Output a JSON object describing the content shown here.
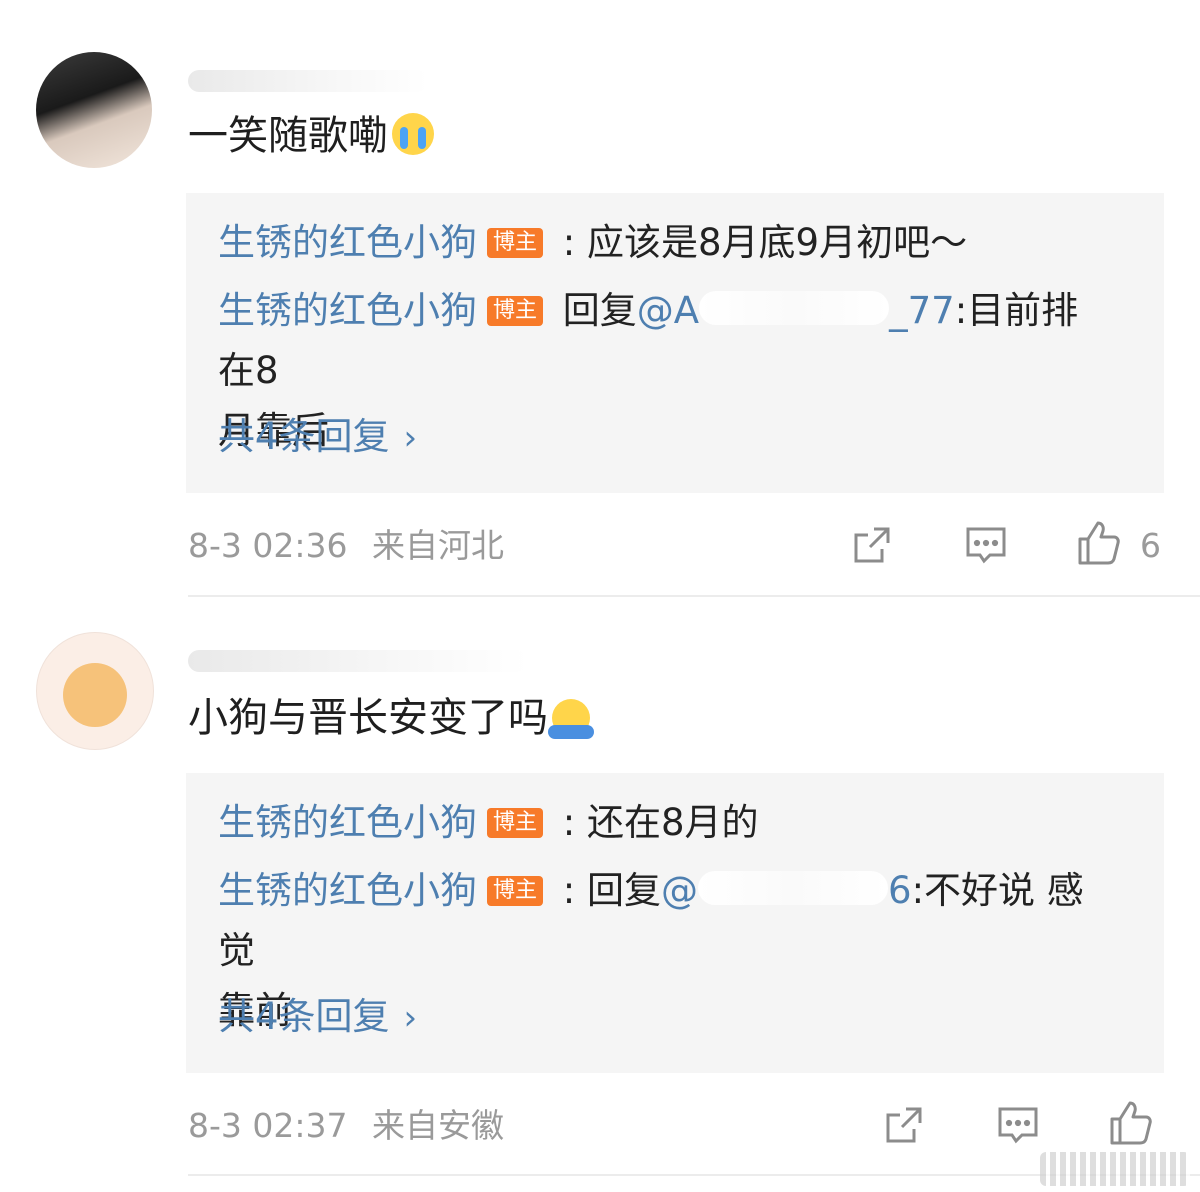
{
  "comments": [
    {
      "text": "一笑随歌嘞",
      "emoji": "crying-face",
      "replies": [
        {
          "user": "生锈的红色小狗",
          "badge": "博主",
          "prefix": " : ",
          "text": "应该是8月底9月初吧～"
        },
        {
          "user": "生锈的红色小狗",
          "badge": "博主",
          "prefix": " 回复",
          "mention": "@A",
          "mention_tail": "_77",
          "text": ":目前排在8",
          "text2": "月靠后"
        }
      ],
      "more": "共4条回复",
      "time": "8-3 02:36",
      "location": "来自河北",
      "likes": "6"
    },
    {
      "text": "小狗与晋长安变了吗",
      "emoji": "hug-face",
      "replies": [
        {
          "user": "生锈的红色小狗",
          "badge": "博主",
          "prefix": " : ",
          "text": "还在8月的"
        },
        {
          "user": "生锈的红色小狗",
          "badge": "博主",
          "prefix": " : 回复",
          "mention": "@",
          "mention_tail": "6",
          "text": ":不好说 感觉",
          "text2": "靠前"
        }
      ],
      "more": "共4条回复",
      "time": "8-3 02:37",
      "location": "来自安徽",
      "likes": ""
    }
  ],
  "icons": {
    "share": "share-icon",
    "comment": "comment-icon",
    "like": "thumbs-up-icon"
  },
  "colors": {
    "username": "#4e7fb0",
    "badge": "#f77a29",
    "meta": "#9a9a9a",
    "reply_bg": "#f5f5f5"
  }
}
